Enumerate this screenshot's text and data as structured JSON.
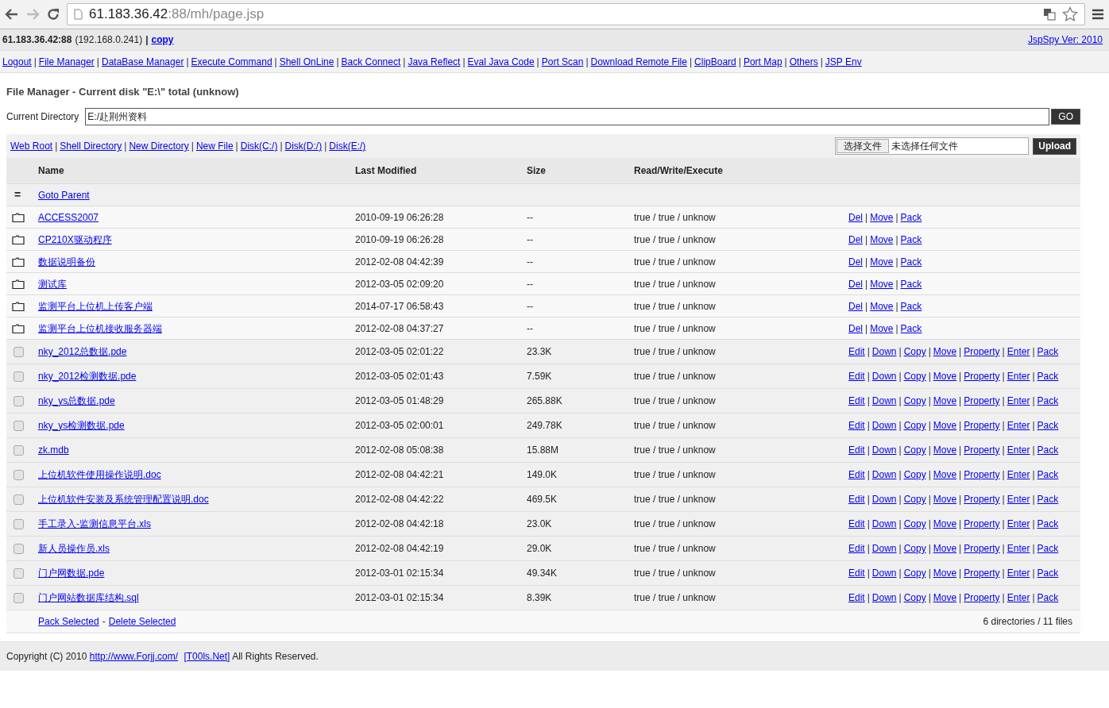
{
  "browser": {
    "url_host": "61.183.36.42",
    "url_rest": ":88/mh/page.jsp"
  },
  "info_bar": {
    "host": "61.183.36.42:88",
    "ip": "(192.168.0.241)",
    "separator": "|",
    "copy_link": "copy",
    "version_link": "JspSpy Ver: 2010"
  },
  "separator": "|",
  "nav_links": [
    "Logout",
    "File Manager",
    "DataBase Manager",
    "Execute Command",
    "Shell OnLine",
    "Back Connect",
    "Java Reflect",
    "Eval Java Code",
    "Port Scan",
    "Download Remote File",
    "ClipBoard",
    "Port Map",
    "Others",
    "JSP Env"
  ],
  "title": "File Manager - Current disk \"E:\\\" total (unknow)",
  "directory": {
    "label": "Current Directory",
    "value": "E:/赴荆州资料",
    "go": "GO"
  },
  "tool_links": [
    "Web Root",
    "Shell Directory",
    "New Directory",
    "New File",
    "Disk(C:/)",
    "Disk(D:/)",
    "Disk(E:/)"
  ],
  "upload": {
    "choose": "选择文件",
    "status": "未选择任何文件",
    "button": "Upload"
  },
  "columns": [
    "Name",
    "Last Modified",
    "Size",
    "Read/Write/Execute"
  ],
  "parent": {
    "icon": "=",
    "label": "Goto Parent"
  },
  "rows": [
    {
      "kind": "dir",
      "name": "ACCESS2007",
      "modified": "2010-09-19 06:26:28",
      "size": "--",
      "rwx": "true / true / unknow",
      "actions": [
        "Del",
        "Move",
        "Pack"
      ]
    },
    {
      "kind": "dir",
      "name": "CP210X驱动程序",
      "modified": "2010-09-19 06:26:28",
      "size": "--",
      "rwx": "true / true / unknow",
      "actions": [
        "Del",
        "Move",
        "Pack"
      ]
    },
    {
      "kind": "dir",
      "name": "数据说明备份",
      "modified": "2012-02-08 04:42:39",
      "size": "--",
      "rwx": "true / true / unknow",
      "actions": [
        "Del",
        "Move",
        "Pack"
      ]
    },
    {
      "kind": "dir",
      "name": "测试库",
      "modified": "2012-03-05 02:09:20",
      "size": "--",
      "rwx": "true / true / unknow",
      "actions": [
        "Del",
        "Move",
        "Pack"
      ]
    },
    {
      "kind": "dir",
      "name": "监测平台上位机上传客户端",
      "modified": "2014-07-17 06:58:43",
      "size": "--",
      "rwx": "true / true / unknow",
      "actions": [
        "Del",
        "Move",
        "Pack"
      ]
    },
    {
      "kind": "dir",
      "name": "监测平台上位机接收服务器端",
      "modified": "2012-02-08 04:37:27",
      "size": "--",
      "rwx": "true / true / unknow",
      "actions": [
        "Del",
        "Move",
        "Pack"
      ]
    },
    {
      "kind": "file",
      "checked": false,
      "name": "nky_2012总数据.pde",
      "modified": "2012-03-05 02:01:22",
      "size": "23.3K",
      "rwx": "true / true / unknow",
      "actions": [
        "Edit",
        "Down",
        "Copy",
        "Move",
        "Property",
        "Enter",
        "Pack"
      ]
    },
    {
      "kind": "file",
      "checked": false,
      "name": "nky_2012检测数据.pde",
      "modified": "2012-03-05 02:01:43",
      "size": "7.59K",
      "rwx": "true / true / unknow",
      "actions": [
        "Edit",
        "Down",
        "Copy",
        "Move",
        "Property",
        "Enter",
        "Pack"
      ]
    },
    {
      "kind": "file",
      "checked": false,
      "name": "nky_ys总数据.pde",
      "modified": "2012-03-05 01:48:29",
      "size": "265.88K",
      "rwx": "true / true / unknow",
      "actions": [
        "Edit",
        "Down",
        "Copy",
        "Move",
        "Property",
        "Enter",
        "Pack"
      ]
    },
    {
      "kind": "file",
      "checked": false,
      "name": "nky_ys检测数据.pde",
      "modified": "2012-03-05 02:00:01",
      "size": "249.78K",
      "rwx": "true / true / unknow",
      "actions": [
        "Edit",
        "Down",
        "Copy",
        "Move",
        "Property",
        "Enter",
        "Pack"
      ]
    },
    {
      "kind": "file",
      "checked": false,
      "name": "zk.mdb",
      "modified": "2012-02-08 05:08:38",
      "size": "15.88M",
      "rwx": "true / true / unknow",
      "actions": [
        "Edit",
        "Down",
        "Copy",
        "Move",
        "Property",
        "Enter",
        "Pack"
      ]
    },
    {
      "kind": "file",
      "checked": false,
      "name": "上位机软件使用操作说明.doc",
      "modified": "2012-02-08 04:42:21",
      "size": "149.0K",
      "rwx": "true / true / unknow",
      "actions": [
        "Edit",
        "Down",
        "Copy",
        "Move",
        "Property",
        "Enter",
        "Pack"
      ]
    },
    {
      "kind": "file",
      "checked": false,
      "name": "上位机软件安装及系统管理配置说明.doc",
      "modified": "2012-02-08 04:42:22",
      "size": "469.5K",
      "rwx": "true / true / unknow",
      "actions": [
        "Edit",
        "Down",
        "Copy",
        "Move",
        "Property",
        "Enter",
        "Pack"
      ]
    },
    {
      "kind": "file",
      "checked": false,
      "name": "手工录入-监测信息平台.xls",
      "modified": "2012-02-08 04:42:18",
      "size": "23.0K",
      "rwx": "true / true / unknow",
      "actions": [
        "Edit",
        "Down",
        "Copy",
        "Move",
        "Property",
        "Enter",
        "Pack"
      ]
    },
    {
      "kind": "file",
      "checked": false,
      "name": "新人员操作员.xls",
      "modified": "2012-02-08 04:42:19",
      "size": "29.0K",
      "rwx": "true / true / unknow",
      "actions": [
        "Edit",
        "Down",
        "Copy",
        "Move",
        "Property",
        "Enter",
        "Pack"
      ]
    },
    {
      "kind": "file",
      "checked": false,
      "name": "门户网数据.pde",
      "modified": "2012-03-01 02:15:34",
      "size": "49.34K",
      "rwx": "true / true / unknow",
      "actions": [
        "Edit",
        "Down",
        "Copy",
        "Move",
        "Property",
        "Enter",
        "Pack"
      ]
    },
    {
      "kind": "file",
      "checked": false,
      "name": "门户网站数据库结构.sql",
      "modified": "2012-03-01 02:15:34",
      "size": "8.39K",
      "rwx": "true / true / unknow",
      "actions": [
        "Edit",
        "Down",
        "Copy",
        "Move",
        "Property",
        "Enter",
        "Pack"
      ]
    }
  ],
  "table_footer": {
    "pack": "Pack Selected",
    "dash": "-",
    "delete": "Delete Selected",
    "summary": "6 directories / 11 files"
  },
  "copyright": {
    "prefix": "Copyright (C) 2010",
    "link1": "http://www.Forjj.com/",
    "link2": "[T00ls.Net]",
    "suffix": "All Rights Reserved."
  }
}
